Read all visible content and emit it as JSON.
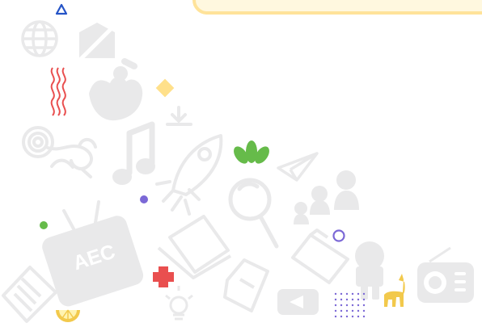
{
  "header": {
    "card": ""
  },
  "icons": {
    "triangle": "triangle-icon",
    "globe": "globe-icon",
    "no_home": "no-home-icon",
    "waves": "wave-icon",
    "sign_language": "sign-language-hand-icon",
    "diamond": "diamond-icon",
    "download": "download-icon",
    "monkey": "monkey-icon",
    "music_note": "music-note-icon",
    "rocket": "rocket-icon",
    "leaves": "leaf-icon",
    "paper_plane": "paper-plane-icon",
    "magnifier": "magnifying-glass-icon",
    "people": "people-icon",
    "tv": "television-icon",
    "laptop": "laptop-icon",
    "book": "book-icon",
    "document": "document-icon",
    "house": "house-icon",
    "folder": "folder-icon",
    "person": "person-icon",
    "radio": "radio-icon",
    "video": "video-play-icon",
    "dots": "dot-grid-icon",
    "llama": "llama-icon",
    "lightbulb": "lightbulb-icon",
    "lemon": "lemon-slice-icon",
    "cross": "plus-cross-icon"
  },
  "labels": {
    "tv_text": "AEC"
  },
  "colors": {
    "ghost_gray": "#e9e9ea",
    "blue": "#2554c7",
    "red": "#e94f4f",
    "yellow": "#ffe08a",
    "green": "#66bb4a",
    "purple": "#7b68d6",
    "amber": "#f2c94c"
  }
}
